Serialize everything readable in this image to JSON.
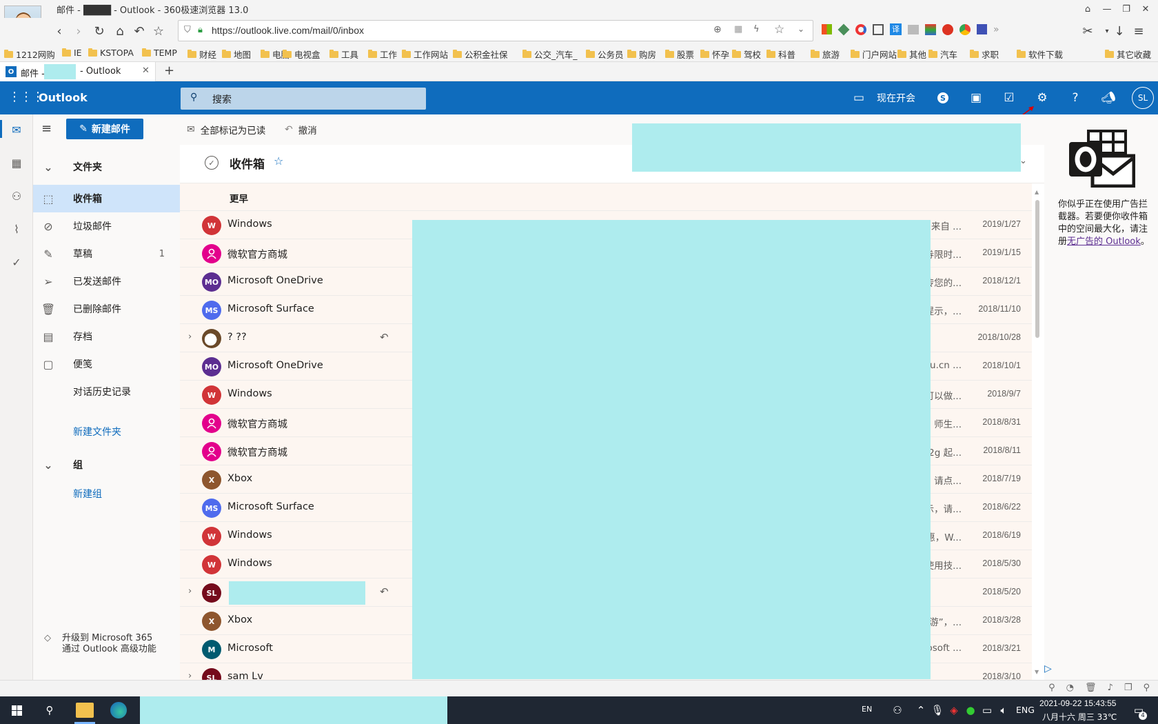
{
  "browser": {
    "title": "邮件 - ████ - Outlook - 360极速浏览器 13.0",
    "url": "https://outlook.live.com/mail/0/inbox",
    "bookmarks": [
      "1212网购",
      "IE",
      "KSTOPA",
      "TEMP",
      "财经",
      "地图",
      "电脑",
      "电视盒",
      "工具",
      "工作",
      "工作网站",
      "公积金社保",
      "公交_汽车_",
      "公务员",
      "购房",
      "股票",
      "怀孕",
      "驾校",
      "科普",
      "旅游",
      "门户网站",
      "其他",
      "汽车",
      "求职",
      "软件下载",
      "其它收藏"
    ],
    "tab_prefix": "邮件 -",
    "tab_suffix": "- Outlook"
  },
  "header": {
    "app_name": "Outlook",
    "search_placeholder": "搜索",
    "meet_now": "现在开会",
    "avatar_initials": "SL"
  },
  "folders": {
    "new_mail": "新建邮件",
    "section_title": "文件夹",
    "items": [
      {
        "label": "收件箱",
        "icon": "inbox-icon",
        "count": ""
      },
      {
        "label": "垃圾邮件",
        "icon": "junk-icon",
        "count": ""
      },
      {
        "label": "草稿",
        "icon": "drafts-icon",
        "count": "1"
      },
      {
        "label": "已发送邮件",
        "icon": "sent-icon",
        "count": ""
      },
      {
        "label": "已删除邮件",
        "icon": "deleted-icon",
        "count": ""
      },
      {
        "label": "存档",
        "icon": "archive-icon",
        "count": ""
      },
      {
        "label": "便笺",
        "icon": "notes-icon",
        "count": ""
      },
      {
        "label": "对话历史记录",
        "icon": "",
        "count": ""
      }
    ],
    "new_folder": "新建文件夹",
    "groups_title": "组",
    "new_group": "新建组",
    "upgrade_text": "升级到 Microsoft 365 通过 Outlook 高级功能"
  },
  "commands": {
    "mark_all_read": "全部标记为已读",
    "undo": "撤消"
  },
  "inbox": {
    "title": "收件箱",
    "group_label": "更早",
    "messages": [
      {
        "initials": "W",
        "color": "#d13438",
        "sender": "Windows",
        "preview": "来自 ...",
        "date": "2019/1/27",
        "chev": "",
        "reply": ""
      },
      {
        "initials": "",
        "color": "#e3008c",
        "sender": "微软官方商城",
        "preview": "券限时...",
        "date": "2019/1/15",
        "chev": "",
        "reply": ""
      },
      {
        "initials": "MO",
        "color": "#5c2e91",
        "sender": "Microsoft OneDrive",
        "preview": "传您的...",
        "date": "2018/12/1",
        "chev": "",
        "reply": ""
      },
      {
        "initials": "MS",
        "color": "#4f6bed",
        "sender": "Microsoft Surface",
        "preview": "提示，...",
        "date": "2018/11/10",
        "chev": "",
        "reply": ""
      },
      {
        "initials": "",
        "color": "#8a8886",
        "sender": "? ??",
        "preview": "",
        "date": "2018/10/28",
        "chev": "›",
        "reply": "↶"
      },
      {
        "initials": "MO",
        "color": "#5c2e91",
        "sender": "Microsoft OneDrive",
        "preview": "du.cn ...",
        "date": "2018/10/1",
        "chev": "",
        "reply": ""
      },
      {
        "initials": "W",
        "color": "#d13438",
        "sender": "Windows",
        "preview": "可以做...",
        "date": "2018/9/7",
        "chev": "",
        "reply": ""
      },
      {
        "initials": "",
        "color": "#e3008c",
        "sender": "微软官方商城",
        "preview": "师生...",
        "date": "2018/8/31",
        "chev": "",
        "reply": ""
      },
      {
        "initials": "",
        "color": "#e3008c",
        "sender": "微软官方商城",
        "preview": "2g 起...",
        "date": "2018/8/11",
        "chev": "",
        "reply": ""
      },
      {
        "initials": "X",
        "color": "#8e562e",
        "sender": "Xbox",
        "preview": "，请点...",
        "date": "2018/7/19",
        "chev": "",
        "reply": ""
      },
      {
        "initials": "MS",
        "color": "#4f6bed",
        "sender": "Microsoft Surface",
        "preview": "示，请...",
        "date": "2018/6/22",
        "chev": "",
        "reply": ""
      },
      {
        "initials": "W",
        "color": "#d13438",
        "sender": "Windows",
        "preview": "惠，W...",
        "date": "2018/6/19",
        "chev": "",
        "reply": ""
      },
      {
        "initials": "W",
        "color": "#d13438",
        "sender": "Windows",
        "preview": "使用技...",
        "date": "2018/5/30",
        "chev": "",
        "reply": ""
      },
      {
        "initials": "SL",
        "color": "#750b1c",
        "sender": "",
        "preview": "",
        "date": "2018/5/20",
        "chev": "›",
        "reply": "↶"
      },
      {
        "initials": "X",
        "color": "#8e562e",
        "sender": "Xbox",
        "preview": "“游”，...",
        "date": "2018/3/28",
        "chev": "",
        "reply": ""
      },
      {
        "initials": "M",
        "color": "#005b70",
        "sender": "Microsoft",
        "preview": "osoft ...",
        "date": "2018/3/21",
        "chev": "",
        "reply": ""
      },
      {
        "initials": "SL",
        "color": "#750b1c",
        "sender": "sam Lv",
        "preview": "",
        "date": "2018/3/10",
        "chev": "›",
        "reply": ""
      }
    ]
  },
  "ad": {
    "text": "你似乎正在使用广告拦截器。若要便你收件箱中的空间最大化，请注册",
    "link": "无广告的 Outlook",
    "tail": "。"
  },
  "taskbar": {
    "datetime": "2021-09-22 15:43:55",
    "lunar": "八月十六 周三 33℃",
    "lang": "ENG",
    "ime": "EN",
    "notif_count": "4"
  }
}
